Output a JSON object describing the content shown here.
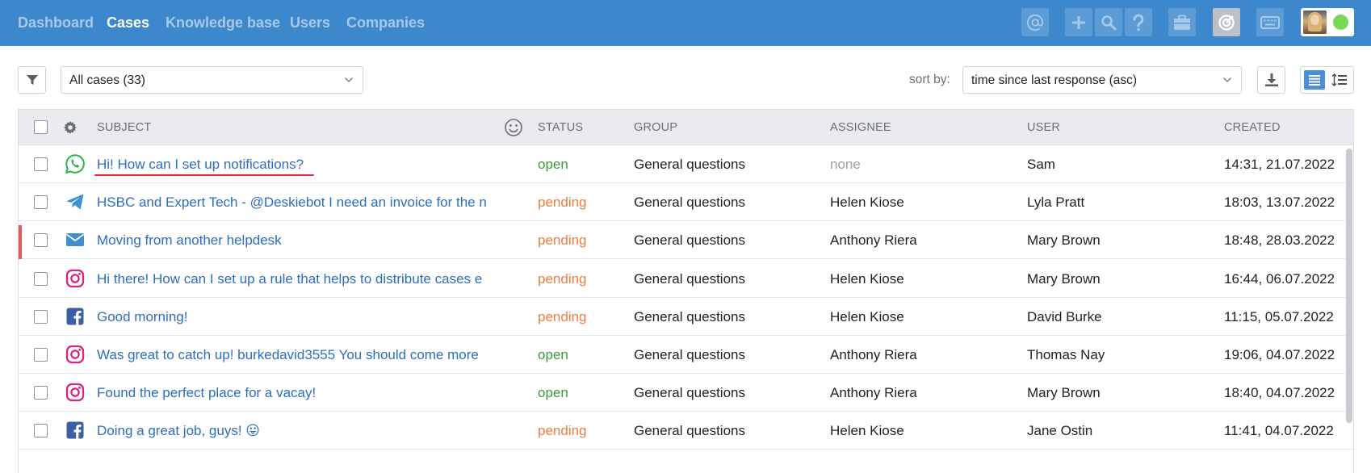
{
  "nav": {
    "items": [
      {
        "label": "Dashboard",
        "active": false
      },
      {
        "label": "Cases",
        "active": true
      },
      {
        "label": "Knowledge base",
        "active": false
      },
      {
        "label": "Users",
        "active": false
      },
      {
        "label": "Companies",
        "active": false
      }
    ],
    "toolbar_icons": [
      "at-sign-icon",
      "plus-icon",
      "search-icon",
      "question-icon",
      "briefcase-icon",
      "target-icon",
      "keyboard-icon"
    ],
    "colors": {
      "bar": "#3d87cc",
      "button": "#5b9bd6",
      "status_online": "#7bd855"
    }
  },
  "toolbar": {
    "filter_icon": "funnel-icon",
    "case_filter": {
      "value": "All cases (33)"
    },
    "sort_label": "sort by:",
    "sort_select": {
      "value": "time since last response (asc)"
    },
    "download_icon": "download-icon",
    "view_modes": [
      "list-view-icon",
      "compact-view-icon"
    ],
    "active_view": "list-view-icon"
  },
  "table": {
    "columns": {
      "subject": "SUBJECT",
      "status": "STATUS",
      "group": "GROUP",
      "assignee": "ASSIGNEE",
      "user": "USER",
      "created": "CREATED"
    },
    "rows": [
      {
        "channel": "whatsapp-icon",
        "subject": "Hi! How can I set up notifications?",
        "status": "open",
        "group": "General questions",
        "assignee": "none",
        "user": "Sam",
        "created": "14:31, 21.07.2022",
        "underlined": true,
        "flagged": false
      },
      {
        "channel": "telegram-icon",
        "subject": "HSBC and Expert Tech - @Deskiebot I need an invoice for the n",
        "status": "pending",
        "group": "General questions",
        "assignee": "Helen Kiose",
        "user": "Lyla Pratt",
        "created": "18:03, 13.07.2022",
        "underlined": false,
        "flagged": false
      },
      {
        "channel": "email-icon",
        "subject": "Moving from another helpdesk",
        "status": "pending",
        "group": "General questions",
        "assignee": "Anthony Riera",
        "user": "Mary Brown",
        "created": "18:48, 28.03.2022",
        "underlined": false,
        "flagged": true
      },
      {
        "channel": "instagram-icon",
        "subject": "Hi there! How can I set up a rule that helps to distribute cases e",
        "status": "pending",
        "group": "General questions",
        "assignee": "Helen Kiose",
        "user": "Mary Brown",
        "created": "16:44, 06.07.2022",
        "underlined": false,
        "flagged": false
      },
      {
        "channel": "facebook-icon",
        "subject": "Good morning!",
        "status": "pending",
        "group": "General questions",
        "assignee": "Helen Kiose",
        "user": "David Burke",
        "created": "11:15, 05.07.2022",
        "underlined": false,
        "flagged": false
      },
      {
        "channel": "instagram-icon",
        "subject": "Was great to catch up! burkedavid3555 You should come more",
        "status": "open",
        "group": "General questions",
        "assignee": "Anthony Riera",
        "user": "Thomas Nay",
        "created": "19:06, 04.07.2022",
        "underlined": false,
        "flagged": false
      },
      {
        "channel": "instagram-icon",
        "subject": "Found the perfect place for a vacay!",
        "status": "open",
        "group": "General questions",
        "assignee": "Anthony Riera",
        "user": "Mary Brown",
        "created": "18:40, 04.07.2022",
        "underlined": false,
        "flagged": false
      },
      {
        "channel": "facebook-icon",
        "subject": "Doing a great job, guys! 😛",
        "status": "pending",
        "group": "General questions",
        "assignee": "Helen Kiose",
        "user": "Jane Ostin",
        "created": "11:41, 04.07.2022",
        "underlined": false,
        "flagged": false
      }
    ],
    "colors": {
      "open": "#3a9a3a",
      "pending": "#ee7c3e",
      "subject": "#2c6dbe",
      "flag": "#e8545e",
      "underline": "#e4262f"
    }
  }
}
